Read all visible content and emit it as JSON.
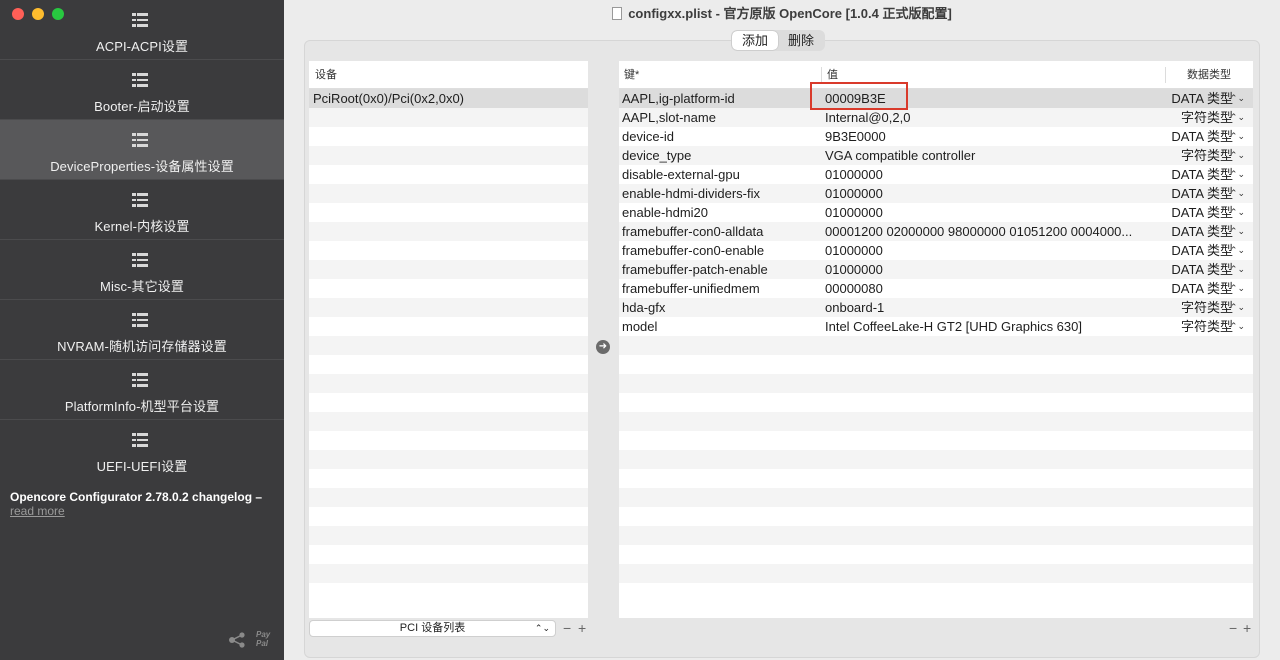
{
  "window": {
    "title": "configxx.plist - 官方原版 OpenCore [1.0.4 正式版配置]"
  },
  "sidebar": {
    "items": [
      {
        "label": "ACPI-ACPI设置"
      },
      {
        "label": "Booter-启动设置"
      },
      {
        "label": "DeviceProperties-设备属性设置"
      },
      {
        "label": "Kernel-内核设置"
      },
      {
        "label": "Misc-其它设置"
      },
      {
        "label": "NVRAM-随机访问存储器设置"
      },
      {
        "label": "PlatformInfo-机型平台设置"
      },
      {
        "label": "UEFI-UEFI设置"
      }
    ],
    "selected_index": 2,
    "changelog": "Opencore Configurator 2.78.0.2 changelog –",
    "read_more": "read more",
    "paypal_line1": "Pay",
    "paypal_line2": "Pal"
  },
  "segmented": {
    "add_label": "添加",
    "delete_label": "删除"
  },
  "devices": {
    "header": "设备",
    "rows": [
      "PciRoot(0x0)/Pci(0x2,0x0)"
    ],
    "footer_select": "PCI 设备列表",
    "add_symbol": "+",
    "remove_symbol": "−"
  },
  "properties": {
    "headers": {
      "key": "键*",
      "value": "值",
      "type": "数据类型"
    },
    "rows": [
      {
        "key": "AAPL,ig-platform-id",
        "value": "00009B3E",
        "type": "DATA 类型"
      },
      {
        "key": "AAPL,slot-name",
        "value": "Internal@0,2,0",
        "type": "字符类型"
      },
      {
        "key": "device-id",
        "value": "9B3E0000",
        "type": "DATA 类型"
      },
      {
        "key": "device_type",
        "value": "VGA compatible controller",
        "type": "字符类型"
      },
      {
        "key": "disable-external-gpu",
        "value": "01000000",
        "type": "DATA 类型"
      },
      {
        "key": "enable-hdmi-dividers-fix",
        "value": "01000000",
        "type": "DATA 类型"
      },
      {
        "key": "enable-hdmi20",
        "value": "01000000",
        "type": "DATA 类型"
      },
      {
        "key": "framebuffer-con0-alldata",
        "value": "00001200 02000000 98000000 01051200 0004000...",
        "type": "DATA 类型"
      },
      {
        "key": "framebuffer-con0-enable",
        "value": "01000000",
        "type": "DATA 类型"
      },
      {
        "key": "framebuffer-patch-enable",
        "value": "01000000",
        "type": "DATA 类型"
      },
      {
        "key": "framebuffer-unifiedmem",
        "value": "00000080",
        "type": "DATA 类型"
      },
      {
        "key": "hda-gfx",
        "value": "onboard-1",
        "type": "字符类型"
      },
      {
        "key": "model",
        "value": "Intel CoffeeLake-H GT2 [UHD Graphics 630]",
        "type": "字符类型"
      }
    ],
    "add_symbol": "+",
    "remove_symbol": "−"
  },
  "colors": {
    "sidebar_bg": "#3b3b3d",
    "sidebar_selected": "#58585a",
    "highlight_border": "#d93a2b"
  }
}
